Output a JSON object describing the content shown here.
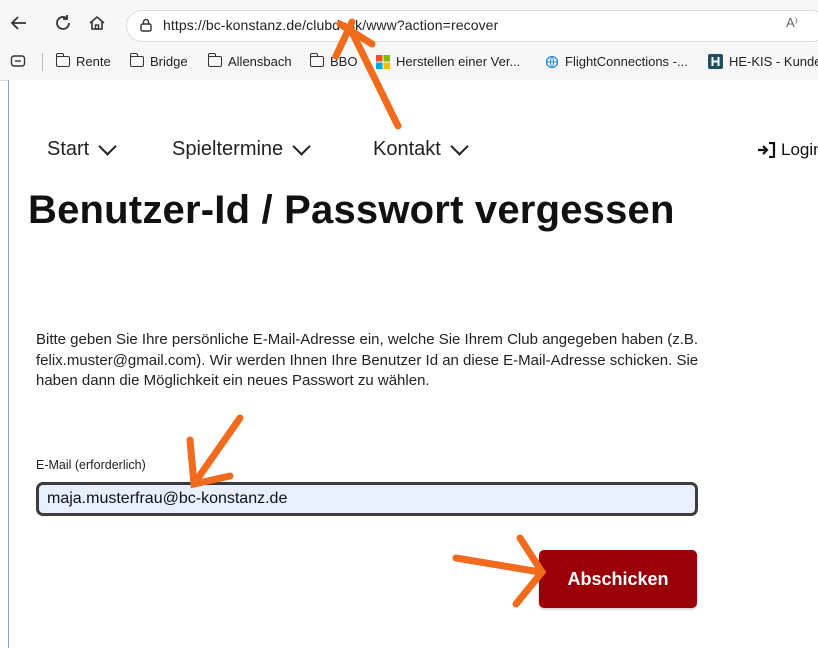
{
  "browser": {
    "url": "https://bc-konstanz.de/clubdesk/www?action=recover",
    "read_aloud": "A⁾",
    "bookmarks": [
      "Rente",
      "Bridge",
      "Allensbach",
      "BBO",
      "Herstellen einer Ver...",
      "FlightConnections -...",
      "HE-KIS - Kunde"
    ]
  },
  "nav": {
    "items": [
      "Start",
      "Spieltermine",
      "Kontakt"
    ],
    "login": "Login"
  },
  "page": {
    "title": "Benutzer-Id / Passwort vergessen",
    "intro": "Bitte geben Sie Ihre persönliche E-Mail-Adresse ein, welche Sie Ihrem Club angegeben haben (z.B. felix.muster@gmail.com). Wir werden Ihnen Ihre Benutzer Id an diese E-Mail-Adresse schicken. Sie haben dann die Möglichkeit ein neues Passwort zu wählen.",
    "email_label": "E-Mail (erforderlich)",
    "email_value": "maja.musterfrau@bc-konstanz.de",
    "submit_label": "Abschicken"
  },
  "colors": {
    "accent": "#9b0009",
    "annotation_arrow": "#f26a1b"
  }
}
